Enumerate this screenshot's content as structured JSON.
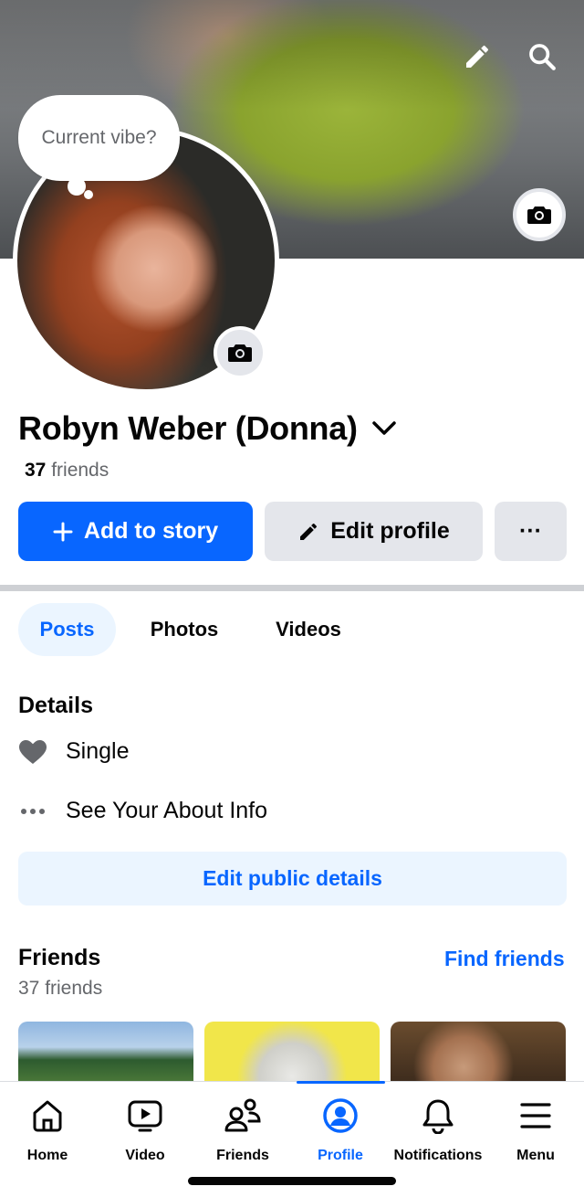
{
  "cover": {
    "edit_icon": "pencil-icon",
    "search_icon": "search-icon",
    "camera_icon": "camera-icon"
  },
  "profile": {
    "thought_bubble": "Current vibe?",
    "name": "Robyn Weber (Donna)",
    "friends_number": "37",
    "friends_word": "friends"
  },
  "actions": {
    "add_story": "Add to story",
    "edit_profile": "Edit profile",
    "more": "···"
  },
  "tabs": [
    "Posts",
    "Photos",
    "Videos"
  ],
  "details": {
    "title": "Details",
    "relationship": "Single",
    "about": "See Your About Info",
    "edit_public": "Edit public details"
  },
  "friends_section": {
    "title": "Friends",
    "count": "37 friends",
    "find_friends": "Find friends"
  },
  "bottom_nav": [
    {
      "label": "Home",
      "icon": "home-icon"
    },
    {
      "label": "Video",
      "icon": "video-icon"
    },
    {
      "label": "Friends",
      "icon": "friends-icon"
    },
    {
      "label": "Profile",
      "icon": "profile-icon"
    },
    {
      "label": "Notifications",
      "icon": "bell-icon"
    },
    {
      "label": "Menu",
      "icon": "menu-icon"
    }
  ],
  "colors": {
    "accent": "#0866ff",
    "button_gray": "#e4e6eb",
    "light_blue": "#ebf5ff",
    "secondary_text": "#65676b"
  }
}
